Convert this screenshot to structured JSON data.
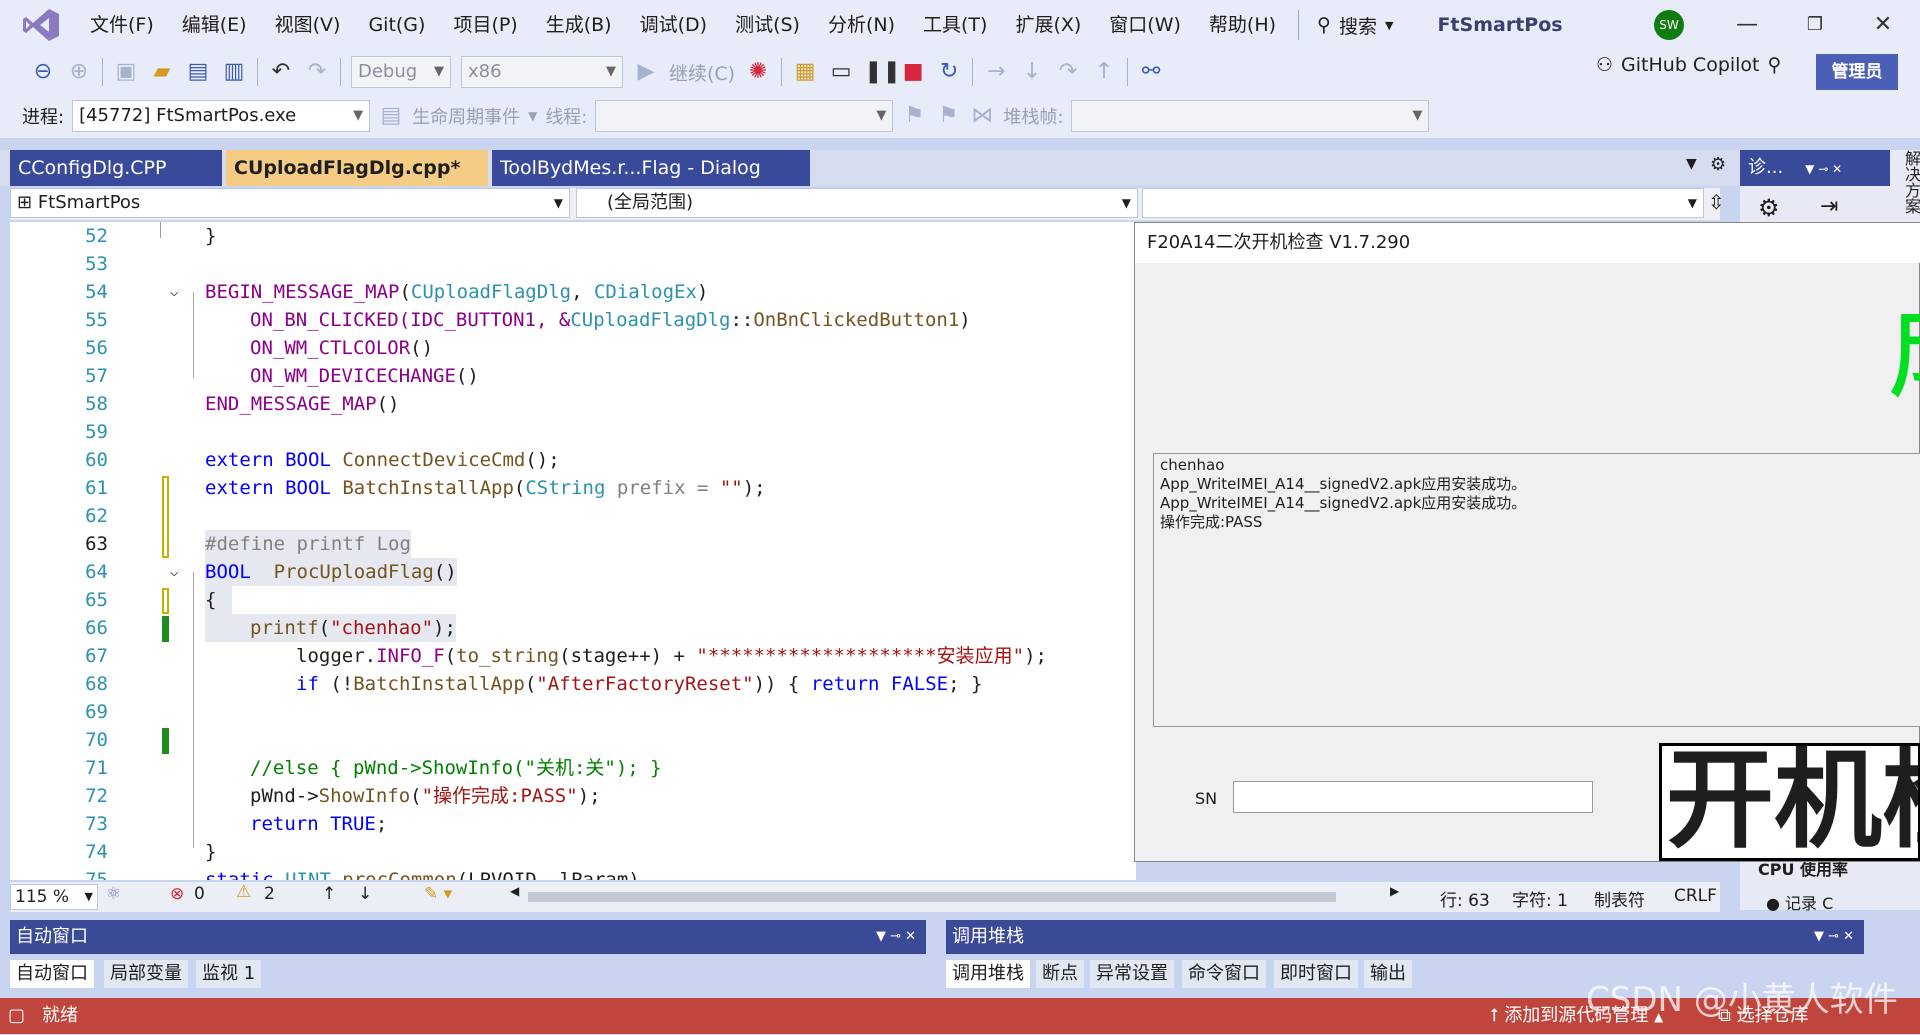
{
  "menu": {
    "items": [
      "文件(F)",
      "编辑(E)",
      "视图(V)",
      "Git(G)",
      "项目(P)",
      "生成(B)",
      "调试(D)",
      "测试(S)",
      "分析(N)",
      "工具(T)",
      "扩展(X)",
      "窗口(W)",
      "帮助(H)"
    ],
    "search_label": "搜索",
    "app_name": "FtSmartPos",
    "avatar": "SW"
  },
  "toolbar": {
    "config": "Debug",
    "platform": "x86",
    "continue_label": "继续(C)",
    "copilot_label": "GitHub Copilot",
    "admin_label": "管理员"
  },
  "toolbar2": {
    "process_label": "进程:",
    "process_value": "[45772] FtSmartPos.exe",
    "lifecycle_label": "生命周期事件",
    "thread_label": "线程:",
    "stackframe_label": "堆栈帧:"
  },
  "tabs": {
    "tab1": "CConfigDlg.CPP",
    "tab2": "CUploadFlagDlg.cpp*",
    "tab3": "ToolBydMes.r...Flag - Dialog",
    "right_tab": "诊...",
    "side_label": "解决方案"
  },
  "nav": {
    "project": "FtSmartPos",
    "scope": "(全局范围)"
  },
  "code": {
    "l52": "}",
    "l54a": "BEGIN_MESSAGE_MAP",
    "l54b": "(",
    "l54c": "CUploadFlagDlg",
    "l54d": ", ",
    "l54e": "CDialogEx",
    "l54f": ")",
    "l55a": "ON_BN_CLICKED",
    "l55b": "(IDC_BUTTON1, &",
    "l55c": "CUploadFlagDlg",
    "l55d": "::",
    "l55e": "OnBnClickedButton1",
    "l55f": ")",
    "l56": "ON_WM_CTLCOLOR",
    "l57": "ON_WM_DEVICECHANGE",
    "l58": "END_MESSAGE_MAP",
    "l60a": "extern",
    "l60b": "BOOL",
    "l60c": "ConnectDeviceCmd",
    "l60d": "();",
    "l61a": "extern",
    "l61b": "BOOL",
    "l61c": "BatchInstallApp",
    "l61d": "(",
    "l61e": "CString",
    "l61f": " prefix = ",
    "l61g": "\"\"",
    "l61h": ");",
    "l63": "#define printf Log",
    "l64a": "BOOL",
    "l64b": "ProcUploadFlag",
    "l64c": "()",
    "l65": "{",
    "l66a": "printf",
    "l66b": "(",
    "l66c": "\"chenhao\"",
    "l66d": ");",
    "l67a": "logger.",
    "l67b": "INFO_F",
    "l67c": "(",
    "l67d": "to_string",
    "l67e": "(stage++) + ",
    "l67f": "\"********************安装应用\"",
    "l67g": ");",
    "l68a": "if",
    "l68b": " (!",
    "l68c": "BatchInstallApp",
    "l68d": "(",
    "l68e": "\"AfterFactoryReset\"",
    "l68f": ")) { ",
    "l68g": "return",
    "l68h": " FALSE",
    "l68i": "; }",
    "l71": "//else { pWnd->ShowInfo(\"关机:关\"); }",
    "l72a": "pWnd->",
    "l72b": "ShowInfo",
    "l72c": "(",
    "l72d": "\"操作完成:PASS\"",
    "l72e": ");",
    "l73a": "return",
    "l73b": " TRUE",
    "l73c": ";",
    "l74": "}",
    "l75a": "static",
    "l75b": " UINT ",
    "l75c": "procCommon",
    "l75d": "(LPVOID  lParam)"
  },
  "line_numbers": [
    "52",
    "53",
    "54",
    "55",
    "56",
    "57",
    "58",
    "59",
    "60",
    "61",
    "62",
    "63",
    "64",
    "65",
    "66",
    "67",
    "68",
    "69",
    "70",
    "71",
    "72",
    "73",
    "74",
    "75"
  ],
  "dialog": {
    "title": "F20A14二次开机检查 V1.7.290",
    "log_lines": [
      "chenhao",
      "App_WriteIMEI_A14__signedV2.apk应用安装成功。",
      "App_WriteIMEI_A14__signedV2.apk应用安装成功。",
      "操作完成:PASS"
    ],
    "sn_label": "SN",
    "big_button": "开机检",
    "green_text": "成"
  },
  "editor_status": {
    "zoom": "115 %",
    "errors": "0",
    "warnings": "2",
    "line": "行: 63",
    "char": "字符: 1",
    "tab": "制表符",
    "eol": "CRLF"
  },
  "right_pane": {
    "cpu_label": "CPU 使用率",
    "record_label": "记录 C"
  },
  "panels": {
    "left_title": "自动窗口",
    "left_tabs": [
      "自动窗口",
      "局部变量",
      "监视 1"
    ],
    "right_title": "调用堆栈",
    "right_tabs": [
      "调用堆栈",
      "断点",
      "异常设置",
      "命令窗口",
      "即时窗口",
      "输出"
    ]
  },
  "statusbar": {
    "ready": "就绪",
    "add_source": "添加到源代码管理",
    "select_repo": "选择仓库",
    "watermark": "CSDN @小黄人软件"
  }
}
